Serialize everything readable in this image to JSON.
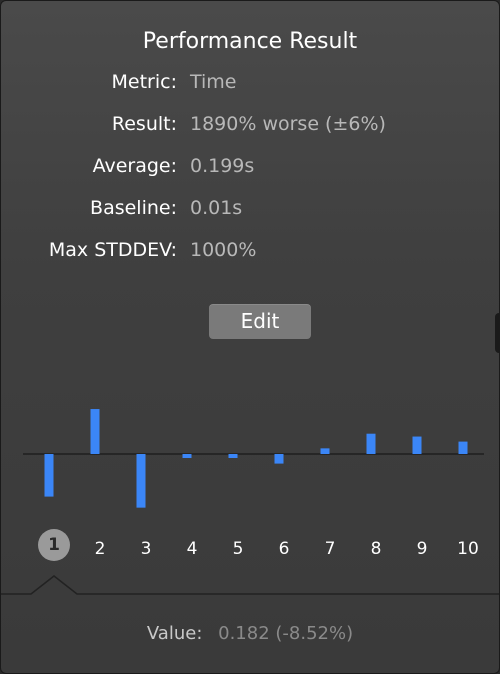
{
  "popover": {
    "title": "Performance Result",
    "metrics": [
      {
        "label": "Metric:",
        "value": "Time"
      },
      {
        "label": "Result:",
        "value": "1890% worse (±6%)"
      },
      {
        "label": "Average:",
        "value": "0.199s"
      },
      {
        "label": "Baseline:",
        "value": "0.01s"
      },
      {
        "label": "Max STDDEV:",
        "value": "1000%"
      }
    ],
    "edit_label": "Edit",
    "footer": {
      "label": "Value:",
      "value": "0.182 (-8.52%)"
    }
  },
  "chart_data": {
    "type": "bar",
    "categories": [
      "1",
      "2",
      "3",
      "4",
      "5",
      "6",
      "7",
      "8",
      "9",
      "10"
    ],
    "values": [
      -8.52,
      8.99,
      -10.73,
      -0.79,
      -0.79,
      -1.92,
      1.13,
      4.06,
      3.49,
      2.48
    ],
    "selected_index": 0,
    "bar_color": "#3b86f7"
  },
  "colors": {
    "background": "#3f3f3f",
    "accent": "#3b86f7",
    "selected_bubble": "#9a9a9a"
  }
}
